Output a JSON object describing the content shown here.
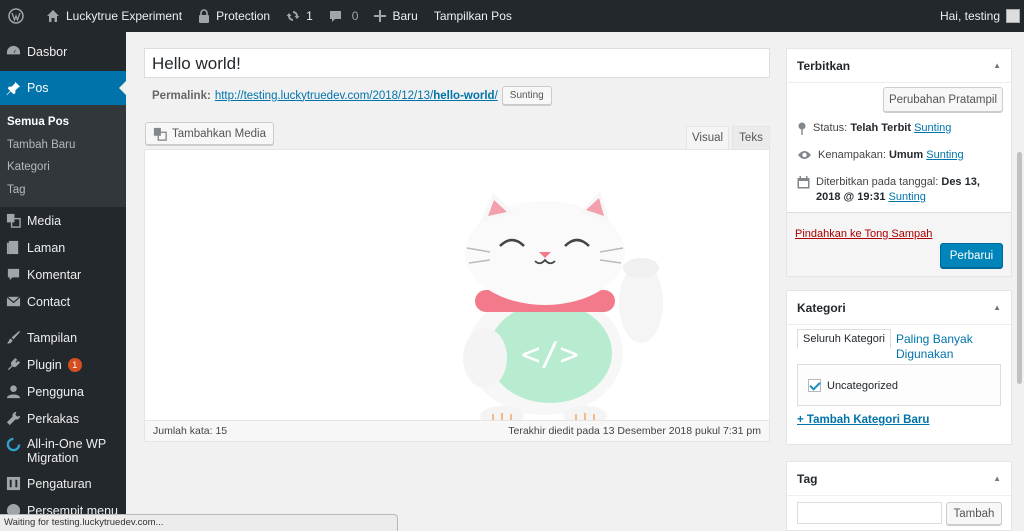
{
  "adminbar": {
    "site_name": "Luckytrue Experiment",
    "protection": "Protection",
    "updates_count": "1",
    "comments_count": "0",
    "new_label": "Baru",
    "view_post": "Tampilkan Pos",
    "greeting": "Hai, testing"
  },
  "menu": {
    "dashboard": "Dasbor",
    "posts": "Pos",
    "posts_sub": [
      "Semua Pos",
      "Tambah Baru",
      "Kategori",
      "Tag"
    ],
    "media": "Media",
    "pages": "Laman",
    "comments": "Komentar",
    "contact": "Contact",
    "appearance": "Tampilan",
    "plugins": "Plugin",
    "plugins_badge": "1",
    "users": "Pengguna",
    "tools": "Perkakas",
    "migration": "All-in-One WP Migration",
    "settings": "Pengaturan",
    "collapse": "Persempit menu"
  },
  "editor": {
    "title": "Hello world!",
    "permalink_label": "Permalink:",
    "permalink_base": "http://testing.luckytruedev.com/2018/12/13/",
    "permalink_slug": "hello-world",
    "permalink_tail": "/",
    "edit_label": "Sunting",
    "add_media": "Tambahkan Media",
    "tab_visual": "Visual",
    "tab_text": "Teks",
    "word_count": "Jumlah kata: 15",
    "last_edited": "Terakhir diedit pada 13 Desember 2018 pukul 7:31 pm"
  },
  "publish": {
    "heading": "Terbitkan",
    "preview_changes": "Perubahan Pratampil",
    "status_label": "Status:",
    "status_value": "Telah Terbit",
    "visibility_label": "Kenampakan:",
    "visibility_value": "Umum",
    "published_label": "Diterbitkan pada tanggal:",
    "published_value": "Des 13, 2018 @ 19:31",
    "edit_label": "Sunting",
    "trash": "Pindahkan ke Tong Sampah",
    "update": "Perbarui"
  },
  "categories": {
    "heading": "Kategori",
    "tab_all": "Seluruh Kategori",
    "tab_popular": "Paling Banyak Digunakan",
    "items": [
      "Uncategorized"
    ],
    "add_new": "+ Tambah Kategori Baru"
  },
  "tags": {
    "heading": "Tag",
    "add": "Tambah",
    "input_value": ""
  },
  "browser_status": "Waiting for testing.luckytruedev.com...",
  "colors": {
    "admin_bar": "#23282d",
    "accent": "#0073aa",
    "button_primary": "#0085ba",
    "badge": "#d54e21",
    "trash": "#a00"
  }
}
